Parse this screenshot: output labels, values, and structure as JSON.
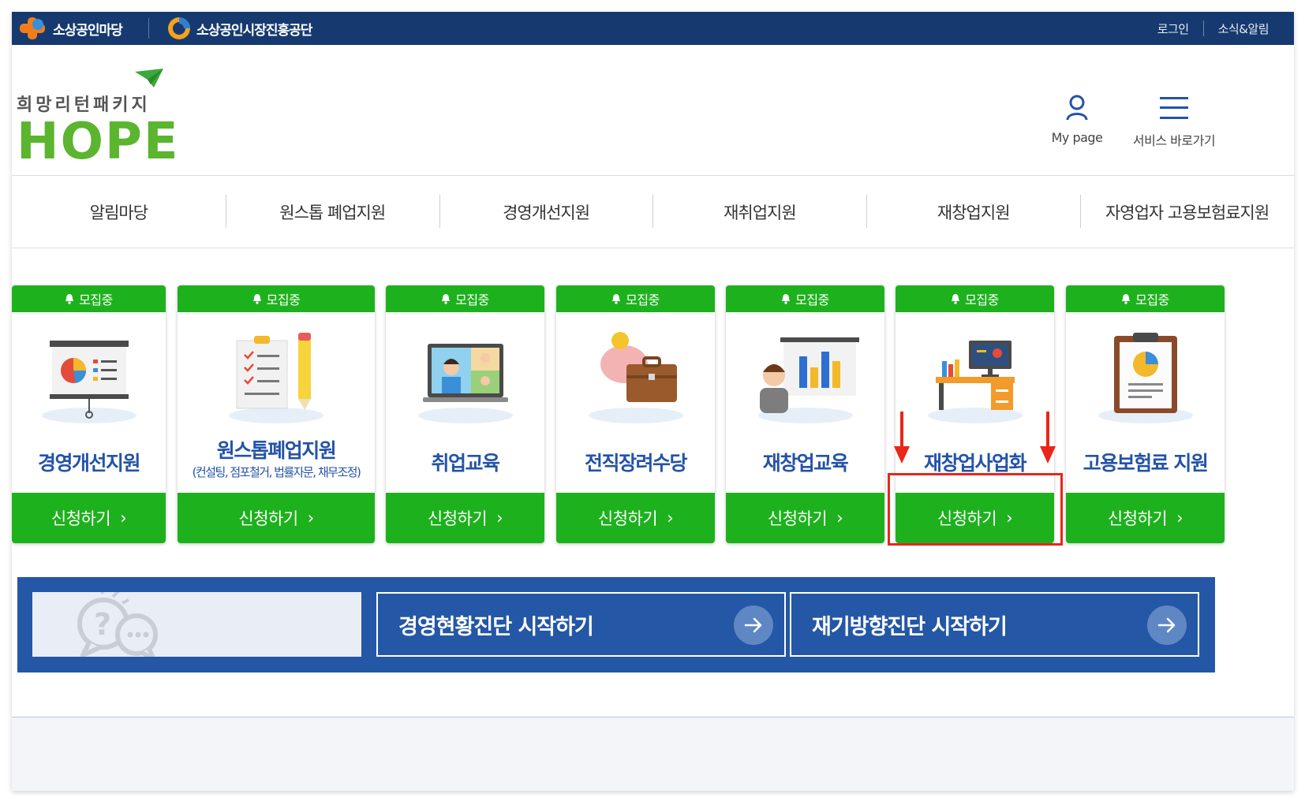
{
  "topbar": {
    "brand_left": "소상공인마당",
    "brand_right": "소상공인시장진흥공단",
    "login": "로그인",
    "news": "소식&알림"
  },
  "header": {
    "logo_korean": "희망리턴패키지",
    "logo_english": "HOPE",
    "mypage_label": "My page",
    "service_label": "서비스 바로가기"
  },
  "nav": {
    "items": [
      "알림마당",
      "원스톱 폐업지원",
      "경영개선지원",
      "재취업지원",
      "재창업지원",
      "자영업자 고용보험료지원"
    ]
  },
  "cards": [
    {
      "badge": "모집중",
      "title": "경영개선지원",
      "apply": "신청하기"
    },
    {
      "badge": "모집중",
      "title": "원스톱폐업지원",
      "sub": "(컨설팅, 점포철거, 법률자문, 채무조정)",
      "apply": "신청하기"
    },
    {
      "badge": "모집중",
      "title": "취업교육",
      "apply": "신청하기"
    },
    {
      "badge": "모집중",
      "title": "전직장려수당",
      "apply": "신청하기"
    },
    {
      "badge": "모집중",
      "title": "재창업교육",
      "apply": "신청하기"
    },
    {
      "badge": "모집중",
      "title": "재창업사업화",
      "apply": "신청하기"
    },
    {
      "badge": "모집중",
      "title": "고용보험료 지원",
      "apply": "신청하기"
    }
  ],
  "banner": {
    "cta1": "경영현황진단 시작하기",
    "cta2": "재기방향진단 시작하기"
  },
  "colors": {
    "topbar": "#163a6f",
    "green": "#1db21d",
    "title_blue": "#2453a8",
    "banner_blue": "#2457a5",
    "highlight_red": "#e8261a",
    "logo_green": "#5bb52f"
  }
}
